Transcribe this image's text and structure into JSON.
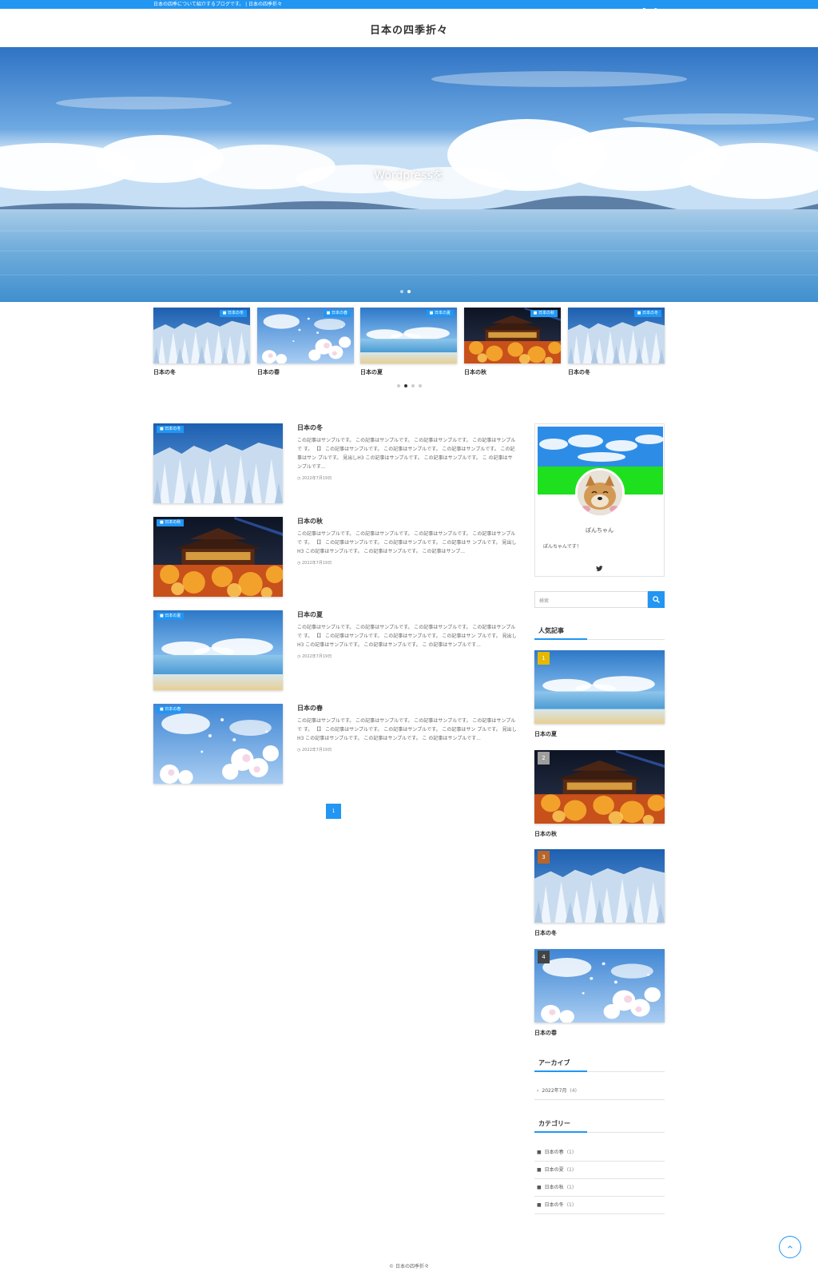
{
  "topbar": {
    "description": "日本の四季について紹介するブログです。 | 日本の四季折々",
    "icons": [
      "twitter-icon",
      "rss-icon",
      "search-icon"
    ]
  },
  "header": {
    "site_title": "日本の四季折々"
  },
  "hero": {
    "caption": "Wordpressを",
    "slides": 2,
    "active_slide": 2
  },
  "carousel": {
    "items": [
      {
        "category": "日本の冬",
        "title": "日本の冬",
        "image": "snow-trees"
      },
      {
        "category": "日本の春",
        "title": "日本の春",
        "image": "cherry-blossoms"
      },
      {
        "category": "日本の夏",
        "title": "日本の夏",
        "image": "beach"
      },
      {
        "category": "日本の秋",
        "title": "日本の秋",
        "image": "temple-night"
      },
      {
        "category": "日本の冬",
        "title": "日本の冬",
        "image": "snow-trees"
      }
    ],
    "dots": 4,
    "active_dot": 2
  },
  "posts": [
    {
      "category": "日本の冬",
      "title": "日本の冬",
      "excerpt": "この記事はサンプルです。 この記事はサンプルです。 この記事はサンプルです。 この記事はサンプルで す。 【】 この記事はサンプルです。 この記事はサンプルです。 この記事はサンプルです。 この記事はサン プルです。 見出しH3 この記事はサンプルです。 この記事はサンプルです。 こ の記事はサンプルです...",
      "date": "2022年7月19日",
      "image": "snow-trees"
    },
    {
      "category": "日本の秋",
      "title": "日本の秋",
      "excerpt": "この記事はサンプルです。 この記事はサンプルです。 この記事はサンプルです。 この記事はサンプルで す。 【】 この記事はサンプルです。 この記事はサンプルです。 この記事はサ ンプルです。 見出しH3 この記事はサンプルです。 この記事はサンプルです。 この記事はサンプ...",
      "date": "2022年7月19日",
      "image": "temple-night"
    },
    {
      "category": "日本の夏",
      "title": "日本の夏",
      "excerpt": "この記事はサンプルです。 この記事はサンプルです。 この記事はサンプルです。 この記事はサンプルで す。 【】 この記事はサンプルです。 この記事はサンプルです。 この記事はサン プルです。 見出しH3 この記事はサンプルです。 この記事はサンプルです。 こ の記事はサンプルです...",
      "date": "2022年7月19日",
      "image": "beach"
    },
    {
      "category": "日本の春",
      "title": "日本の春",
      "excerpt": "この記事はサンプルです。 この記事はサンプルです。 この記事はサンプルです。 この記事はサンプルで す。 【】 この記事はサンプルです。 この記事はサンプルです。 この記事はサン プルです。 見出しH3 この記事はサンプルです。 この記事はサンプルです。 こ の記事はサンプルです...",
      "date": "2022年7月19日",
      "image": "cherry-blossoms"
    }
  ],
  "pagination": {
    "current": "1"
  },
  "sidebar": {
    "profile": {
      "name": "ぽんちゃん",
      "message": "ぽんちゃんです！"
    },
    "search": {
      "placeholder": "検索"
    },
    "popular": {
      "title": "人気記事",
      "items": [
        {
          "rank": "1",
          "title": "日本の夏",
          "image": "beach",
          "badge_color": "#e6b800"
        },
        {
          "rank": "2",
          "title": "日本の秋",
          "image": "temple-night",
          "badge_color": "#9e9e9e"
        },
        {
          "rank": "3",
          "title": "日本の冬",
          "image": "snow-trees",
          "badge_color": "#b8652a"
        },
        {
          "rank": "4",
          "title": "日本の春",
          "image": "cherry-blossoms",
          "badge_color": "#444444"
        }
      ]
    },
    "archive": {
      "title": "アーカイブ",
      "items": [
        {
          "label": "2022年7月",
          "count": "(4)"
        }
      ]
    },
    "categories": {
      "title": "カテゴリー",
      "items": [
        {
          "label": "日本の春",
          "count": "(1)"
        },
        {
          "label": "日本の夏",
          "count": "(1)"
        },
        {
          "label": "日本の秋",
          "count": "(1)"
        },
        {
          "label": "日本の冬",
          "count": "(1)"
        }
      ]
    }
  },
  "footer": {
    "copyright": "© 日本の四季折々"
  },
  "colors": {
    "accent": "#2196f3"
  }
}
